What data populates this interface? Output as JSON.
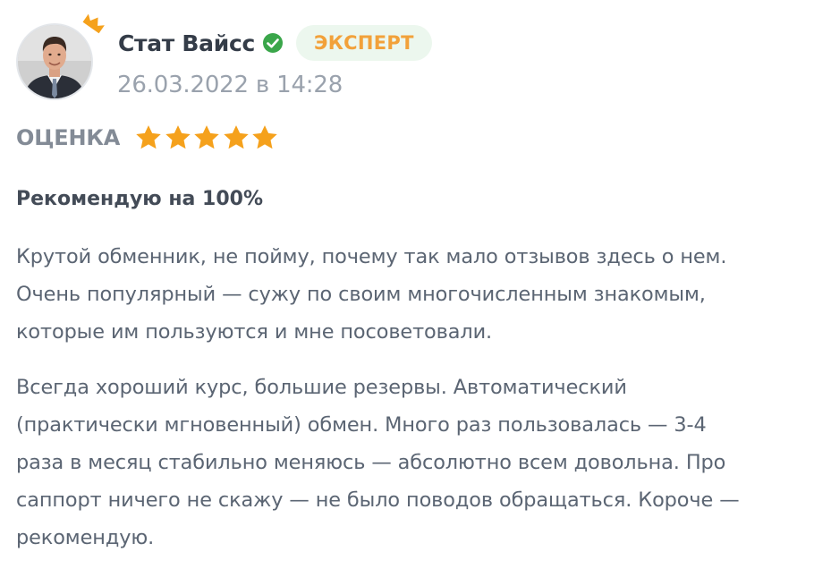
{
  "review": {
    "author": {
      "name": "Стат Вайсс",
      "badge": "ЭКСПЕРТ",
      "avatar_icon": "avatar-photo",
      "crown_icon": "crown-icon",
      "verified_icon": "verified-check-icon"
    },
    "date": "26.03.2022 в 14:28",
    "rating": {
      "label": "ОЦЕНКА",
      "value": 5,
      "max": 5
    },
    "title": "Рекомендую на 100%",
    "paragraphs": [
      {
        "lines": [
          "Крутой обменник, не пойму, почему так мало отзывов здесь о нем.",
          "Очень популярный — сужу по своим многочисленным знакомым,",
          "которые им пользуются и мне посоветовали."
        ]
      },
      {
        "lines": [
          "Всегда хороший курс, большие резервы. Автоматический",
          "(практически мгновенный) обмен. Много раз пользовалась — 3-4",
          "раза в месяц стабильно меняюсь — абсолютно всем довольна. Про",
          "саппорт ничего не скажу — не было поводов обращаться. Короче —",
          "рекомендую."
        ]
      }
    ]
  },
  "colors": {
    "name": "#343c48",
    "date": "#9aa2ad",
    "badge_text": "#f2a13a",
    "badge_bg": "#ecf7ee",
    "star": "#f5a11c",
    "verified": "#3aa64a",
    "crown": "#f5a11c",
    "body_text": "#5b6573"
  }
}
